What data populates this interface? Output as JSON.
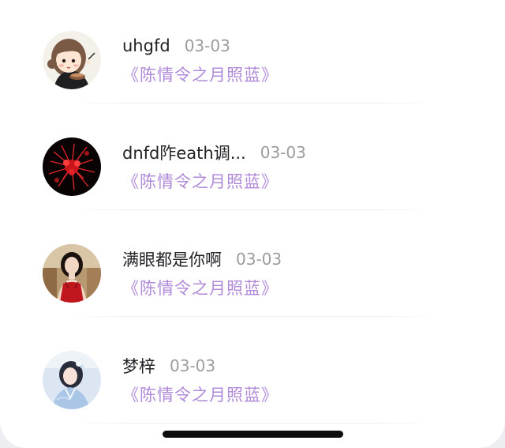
{
  "comments": [
    {
      "name": "uhgfd",
      "date": "03-03",
      "work": "《陈情令之月照蓝》",
      "avatar_icon": "cartoon-girl-avatar"
    },
    {
      "name": "dnfd阼eath调...",
      "date": "03-03",
      "work": "《陈情令之月照蓝》",
      "avatar_icon": "red-spider-lily-avatar"
    },
    {
      "name": "满眼都是你啊",
      "date": "03-03",
      "work": "《陈情令之月照蓝》",
      "avatar_icon": "woman-red-dress-avatar"
    },
    {
      "name": "梦梓",
      "date": "03-03",
      "work": "《陈情令之月照蓝》",
      "avatar_icon": "hanfu-girl-avatar"
    }
  ],
  "colors": {
    "name": "#222326",
    "date": "#9b9ca0",
    "work_link": "#b08ad8"
  }
}
